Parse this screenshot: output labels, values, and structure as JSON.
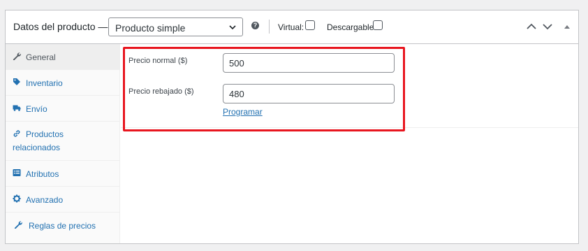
{
  "header": {
    "title": "Datos del producto —",
    "product_type": {
      "selected": "Producto simple"
    },
    "virtual_label": "Virtual:",
    "downloadable_label": "Descargable:"
  },
  "sidebar": {
    "items": [
      {
        "label": "General",
        "icon": "wrench-icon",
        "active": true
      },
      {
        "label": "Inventario",
        "icon": "tag-icon"
      },
      {
        "label": "Envío",
        "icon": "truck-icon"
      },
      {
        "label": "Productos",
        "label2": "relacionados",
        "icon": "link-icon"
      },
      {
        "label": "Atributos",
        "icon": "list-icon"
      },
      {
        "label": "Avanzado",
        "icon": "gear-icon"
      },
      {
        "label": "Reglas de precios",
        "icon": "wrench-icon"
      }
    ]
  },
  "pricing": {
    "regular_price_label": "Precio normal ($)",
    "regular_price_value": "500",
    "sale_price_label": "Precio rebajado ($)",
    "sale_price_value": "480",
    "schedule_link": "Programar"
  },
  "colors": {
    "link": "#2271b1",
    "highlight": "#e8161f",
    "border": "#c3c4c7"
  }
}
